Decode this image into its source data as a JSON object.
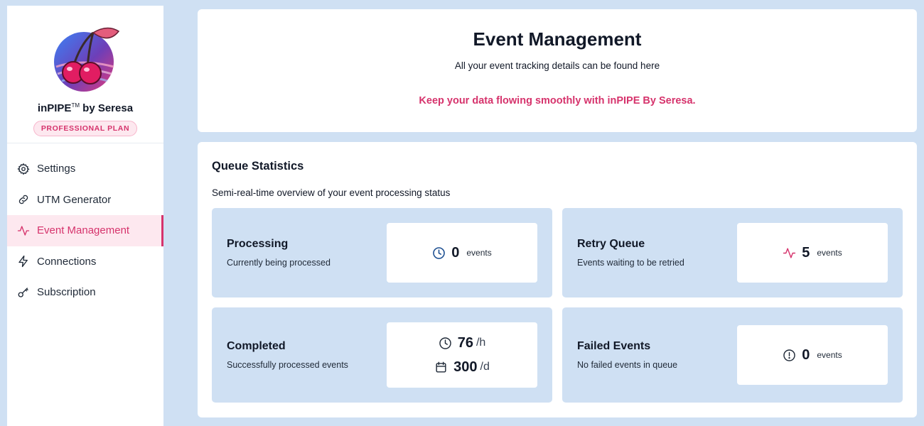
{
  "brand": {
    "name": "inPIPE",
    "tm": "TM",
    "suffix": " by Seresa",
    "plan": "PROFESSIONAL PLAN"
  },
  "nav": {
    "items": [
      {
        "label": "Settings",
        "icon": "gear-icon"
      },
      {
        "label": "UTM Generator",
        "icon": "link-icon"
      },
      {
        "label": "Event Management",
        "icon": "activity-icon",
        "active": true
      },
      {
        "label": "Connections",
        "icon": "lightning-icon"
      },
      {
        "label": "Subscription",
        "icon": "key-icon"
      }
    ]
  },
  "header": {
    "title": "Event Management",
    "subtitle": "All your event tracking details can be found here",
    "tagline": "Keep your data flowing smoothly with inPIPE By Seresa."
  },
  "stats": {
    "title": "Queue Statistics",
    "subtitle": "Semi-real-time overview of your event processing status",
    "processing": {
      "title": "Processing",
      "desc": "Currently being processed",
      "value": "0",
      "unit": "events",
      "icon": "clock-icon"
    },
    "retry": {
      "title": "Retry Queue",
      "desc": "Events waiting to be retried",
      "value": "5",
      "unit": "events",
      "icon": "activity-icon"
    },
    "completed": {
      "title": "Completed",
      "desc": "Successfully processed events",
      "hourly": "76",
      "hourly_unit": "/h",
      "daily": "300",
      "daily_unit": "/d"
    },
    "failed": {
      "title": "Failed Events",
      "desc": "No failed events in queue",
      "value": "0",
      "unit": "events",
      "icon": "alert-circle-icon"
    }
  },
  "colors": {
    "accent": "#d6336c",
    "tile_bg": "#cfe0f3",
    "clock_blue": "#1d4f91"
  }
}
